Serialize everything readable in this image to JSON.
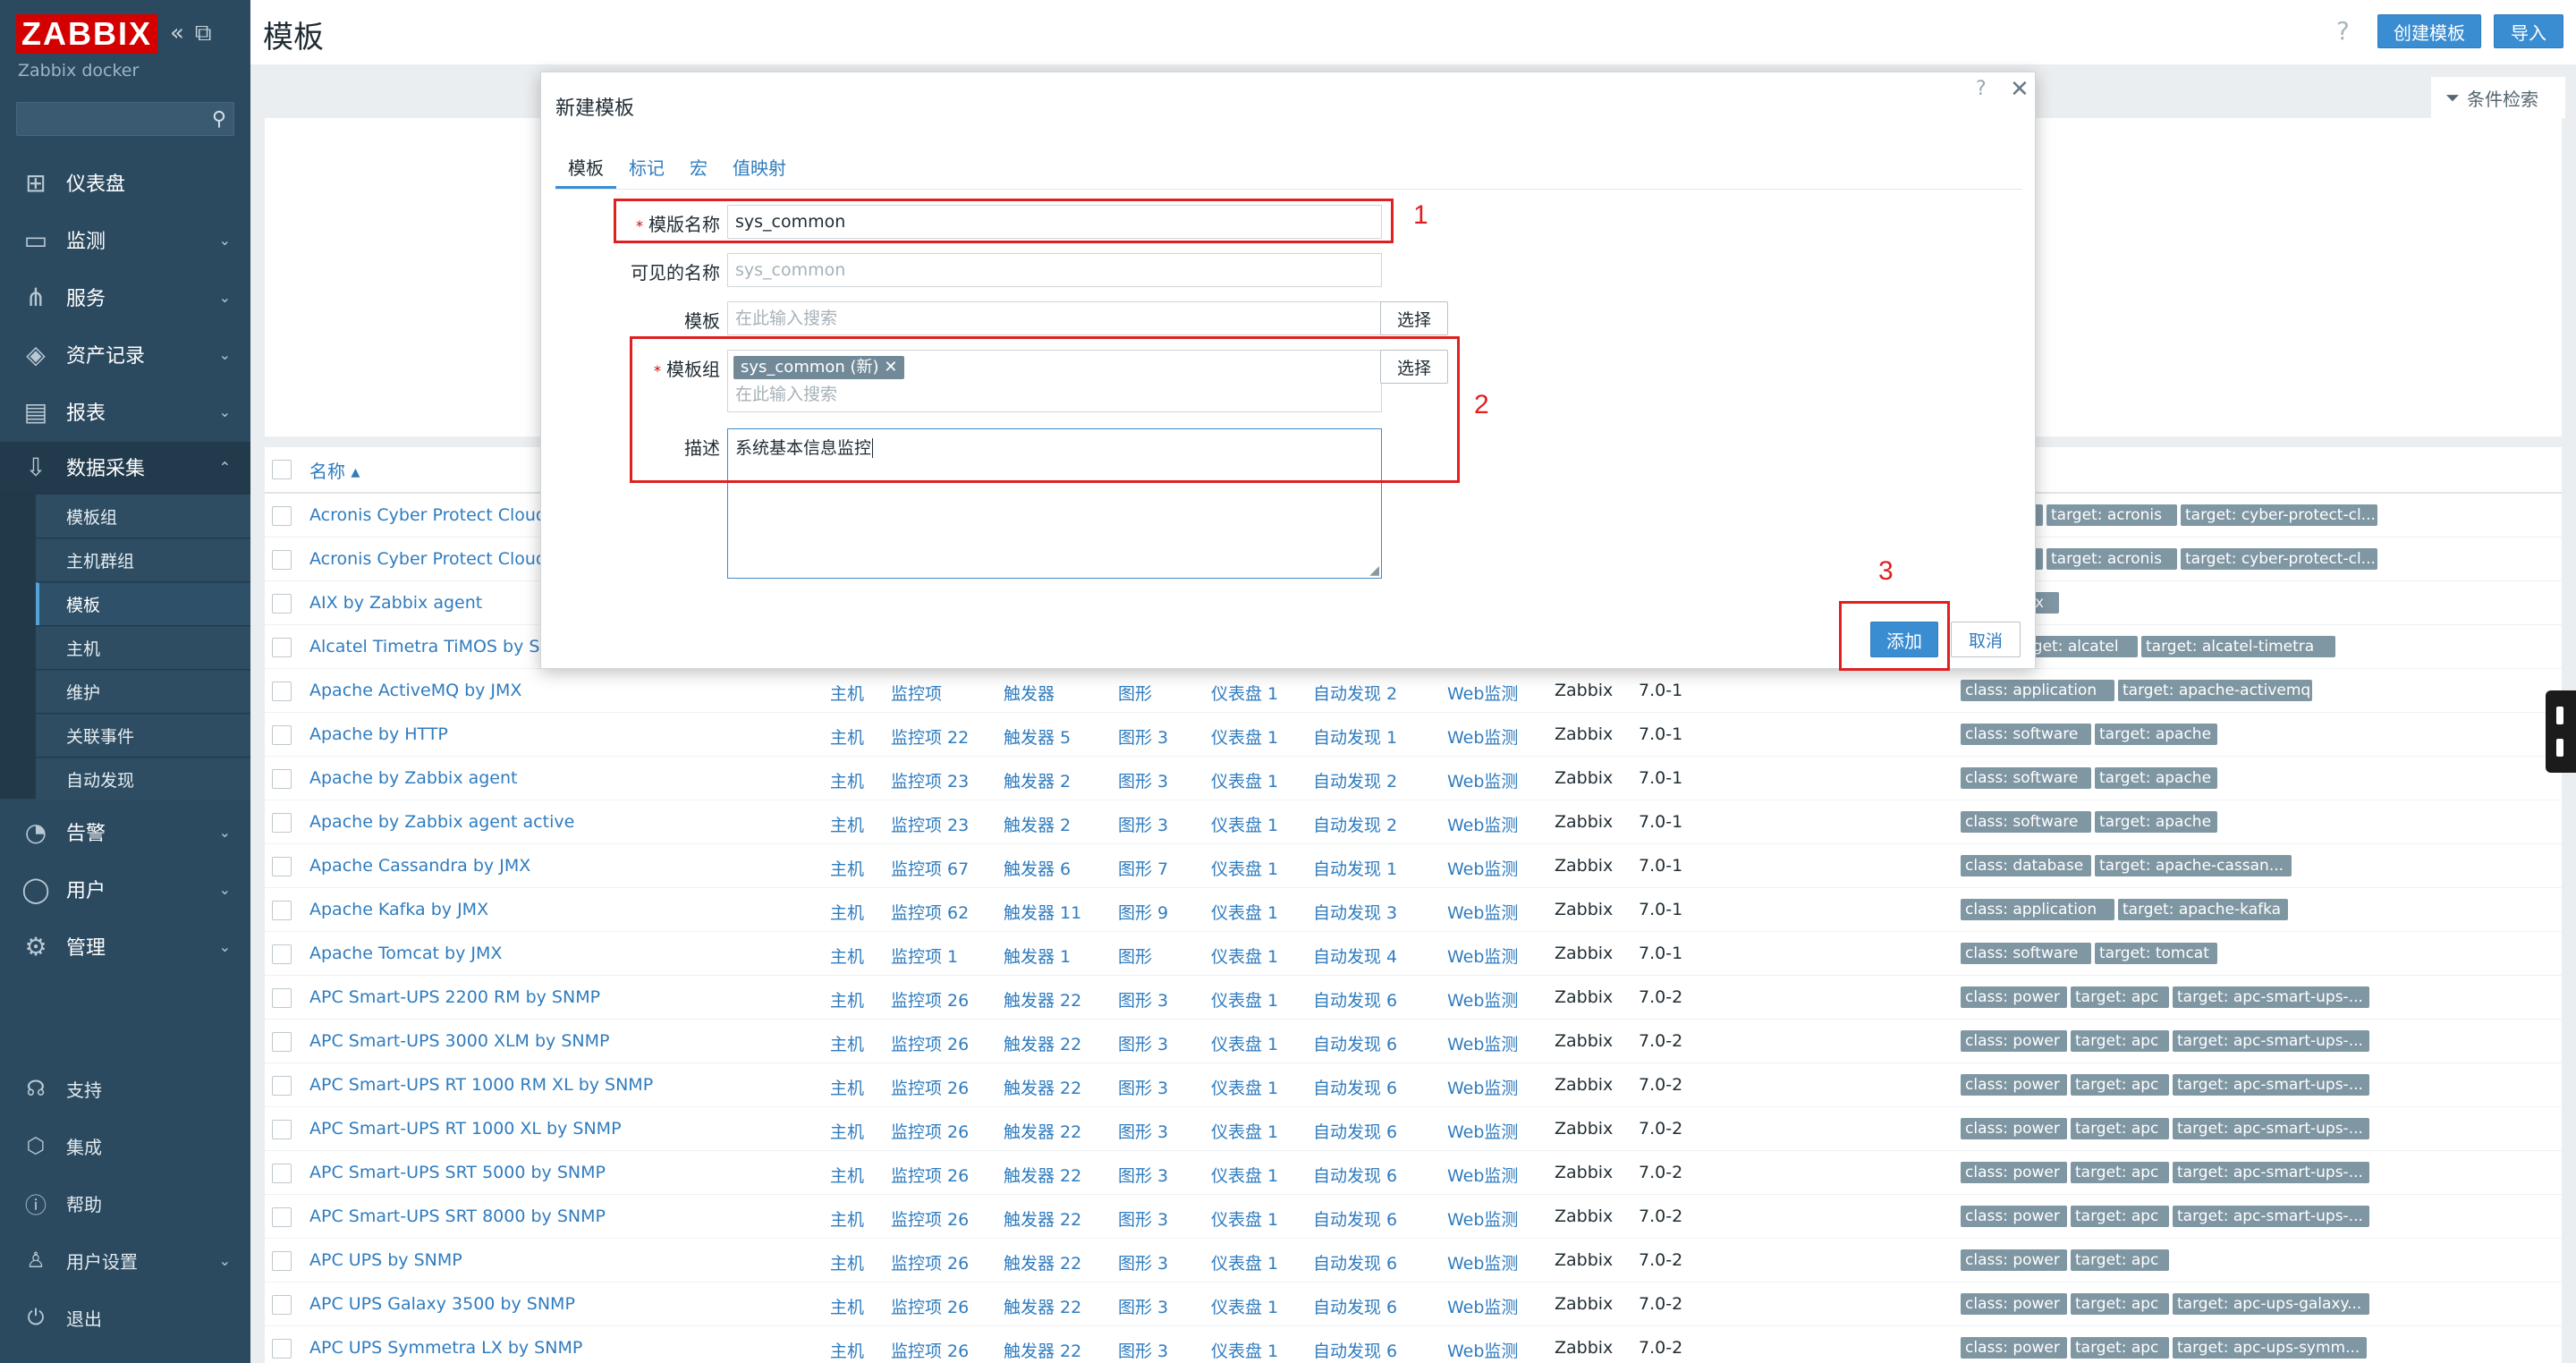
{
  "sidebar": {
    "logo": "ZABBIX",
    "collapse_icons": [
      "«",
      "⧉"
    ],
    "instance": "Zabbix docker",
    "search_placeholder": "",
    "menu": [
      {
        "label": "仪表盘",
        "icon": "dashboard-icon"
      },
      {
        "label": "监测",
        "icon": "monitoring-icon"
      },
      {
        "label": "服务",
        "icon": "services-icon"
      },
      {
        "label": "资产记录",
        "icon": "inventory-icon"
      },
      {
        "label": "报表",
        "icon": "reports-icon"
      },
      {
        "label": "数据采集",
        "icon": "data-collection-icon"
      }
    ],
    "submenu": [
      "模板组",
      "主机群组",
      "模板",
      "主机",
      "维护",
      "关联事件",
      "自动发现"
    ],
    "menu2": [
      {
        "label": "告警",
        "icon": "alerts-icon"
      },
      {
        "label": "用户",
        "icon": "users-icon"
      },
      {
        "label": "管理",
        "icon": "administration-icon"
      }
    ],
    "bottom": [
      {
        "label": "支持",
        "icon": "support-icon"
      },
      {
        "label": "集成",
        "icon": "integrations-icon"
      },
      {
        "label": "帮助",
        "icon": "help-icon"
      },
      {
        "label": "用户设置",
        "icon": "user-settings-icon"
      },
      {
        "label": "退出",
        "icon": "logout-icon"
      }
    ]
  },
  "header": {
    "title": "模板",
    "help": "?",
    "create_button": "创建模板",
    "import_button": "导入",
    "filter_label": "条件检索"
  },
  "table": {
    "name_header": "名称 ▴",
    "rows": [
      {
        "name": "Acronis Cyber Protect Cloud b",
        "tags": [
          "plication",
          "target: acronis",
          "target: cyber-protect-cl..."
        ]
      },
      {
        "name": "Acronis Cyber Protect Cloud M",
        "tags": [
          "plication",
          "target: acronis",
          "target: cyber-protect-cl..."
        ]
      },
      {
        "name": "AIX by Zabbix agent",
        "tags": [
          "target: aix"
        ]
      },
      {
        "name": "Alcatel Timetra TiMOS by SNM",
        "tags": [
          "work",
          "target: alcatel",
          "target: alcatel-timetra"
        ]
      },
      {
        "name": "Apache ActiveMQ by JMX",
        "hosts": "主机",
        "items": "监控项",
        "triggers": "触发器",
        "graphs": "图形",
        "dashboards": "仪表盘 1",
        "discovery": "自动发现 2",
        "web": "Web监测",
        "vendor": "Zabbix",
        "version": "7.0-1",
        "tags": [
          "class: application",
          "target: apache-activemq"
        ]
      },
      {
        "name": "Apache by HTTP",
        "hosts": "主机",
        "items": "监控项 22",
        "triggers": "触发器 5",
        "graphs": "图形 3",
        "dashboards": "仪表盘 1",
        "discovery": "自动发现 1",
        "web": "Web监测",
        "vendor": "Zabbix",
        "version": "7.0-1",
        "tags": [
          "class: software",
          "target: apache"
        ]
      },
      {
        "name": "Apache by Zabbix agent",
        "hosts": "主机",
        "items": "监控项 23",
        "triggers": "触发器 2",
        "graphs": "图形 3",
        "dashboards": "仪表盘 1",
        "discovery": "自动发现 2",
        "web": "Web监测",
        "vendor": "Zabbix",
        "version": "7.0-1",
        "tags": [
          "class: software",
          "target: apache"
        ]
      },
      {
        "name": "Apache by Zabbix agent active",
        "hosts": "主机",
        "items": "监控项 23",
        "triggers": "触发器 2",
        "graphs": "图形 3",
        "dashboards": "仪表盘 1",
        "discovery": "自动发现 2",
        "web": "Web监测",
        "vendor": "Zabbix",
        "version": "7.0-1",
        "tags": [
          "class: software",
          "target: apache"
        ]
      },
      {
        "name": "Apache Cassandra by JMX",
        "hosts": "主机",
        "items": "监控项 67",
        "triggers": "触发器 6",
        "graphs": "图形 7",
        "dashboards": "仪表盘 1",
        "discovery": "自动发现 1",
        "web": "Web监测",
        "vendor": "Zabbix",
        "version": "7.0-1",
        "tags": [
          "class: database",
          "target: apache-cassan..."
        ]
      },
      {
        "name": "Apache Kafka by JMX",
        "hosts": "主机",
        "items": "监控项 62",
        "triggers": "触发器 11",
        "graphs": "图形 9",
        "dashboards": "仪表盘 1",
        "discovery": "自动发现 3",
        "web": "Web监测",
        "vendor": "Zabbix",
        "version": "7.0-1",
        "tags": [
          "class: application",
          "target: apache-kafka"
        ]
      },
      {
        "name": "Apache Tomcat by JMX",
        "hosts": "主机",
        "items": "监控项 1",
        "triggers": "触发器 1",
        "graphs": "图形",
        "dashboards": "仪表盘 1",
        "discovery": "自动发现 4",
        "web": "Web监测",
        "vendor": "Zabbix",
        "version": "7.0-1",
        "tags": [
          "class: software",
          "target: tomcat"
        ]
      },
      {
        "name": "APC Smart-UPS 2200 RM by SNMP",
        "hosts": "主机",
        "items": "监控项 26",
        "triggers": "触发器 22",
        "graphs": "图形 3",
        "dashboards": "仪表盘 1",
        "discovery": "自动发现 6",
        "web": "Web监测",
        "vendor": "Zabbix",
        "version": "7.0-2",
        "tags": [
          "class: power",
          "target: apc",
          "target: apc-smart-ups-..."
        ]
      },
      {
        "name": "APC Smart-UPS 3000 XLM by SNMP",
        "hosts": "主机",
        "items": "监控项 26",
        "triggers": "触发器 22",
        "graphs": "图形 3",
        "dashboards": "仪表盘 1",
        "discovery": "自动发现 6",
        "web": "Web监测",
        "vendor": "Zabbix",
        "version": "7.0-2",
        "tags": [
          "class: power",
          "target: apc",
          "target: apc-smart-ups-..."
        ]
      },
      {
        "name": "APC Smart-UPS RT 1000 RM XL by SNMP",
        "hosts": "主机",
        "items": "监控项 26",
        "triggers": "触发器 22",
        "graphs": "图形 3",
        "dashboards": "仪表盘 1",
        "discovery": "自动发现 6",
        "web": "Web监测",
        "vendor": "Zabbix",
        "version": "7.0-2",
        "tags": [
          "class: power",
          "target: apc",
          "target: apc-smart-ups-..."
        ]
      },
      {
        "name": "APC Smart-UPS RT 1000 XL by SNMP",
        "hosts": "主机",
        "items": "监控项 26",
        "triggers": "触发器 22",
        "graphs": "图形 3",
        "dashboards": "仪表盘 1",
        "discovery": "自动发现 6",
        "web": "Web监测",
        "vendor": "Zabbix",
        "version": "7.0-2",
        "tags": [
          "class: power",
          "target: apc",
          "target: apc-smart-ups-..."
        ]
      },
      {
        "name": "APC Smart-UPS SRT 5000 by SNMP",
        "hosts": "主机",
        "items": "监控项 26",
        "triggers": "触发器 22",
        "graphs": "图形 3",
        "dashboards": "仪表盘 1",
        "discovery": "自动发现 6",
        "web": "Web监测",
        "vendor": "Zabbix",
        "version": "7.0-2",
        "tags": [
          "class: power",
          "target: apc",
          "target: apc-smart-ups-..."
        ]
      },
      {
        "name": "APC Smart-UPS SRT 8000 by SNMP",
        "hosts": "主机",
        "items": "监控项 26",
        "triggers": "触发器 22",
        "graphs": "图形 3",
        "dashboards": "仪表盘 1",
        "discovery": "自动发现 6",
        "web": "Web监测",
        "vendor": "Zabbix",
        "version": "7.0-2",
        "tags": [
          "class: power",
          "target: apc",
          "target: apc-smart-ups-..."
        ]
      },
      {
        "name": "APC UPS by SNMP",
        "hosts": "主机",
        "items": "监控项 26",
        "triggers": "触发器 22",
        "graphs": "图形 3",
        "dashboards": "仪表盘 1",
        "discovery": "自动发现 6",
        "web": "Web监测",
        "vendor": "Zabbix",
        "version": "7.0-2",
        "tags": [
          "class: power",
          "target: apc"
        ]
      },
      {
        "name": "APC UPS Galaxy 3500 by SNMP",
        "hosts": "主机",
        "items": "监控项 26",
        "triggers": "触发器 22",
        "graphs": "图形 3",
        "dashboards": "仪表盘 1",
        "discovery": "自动发现 6",
        "web": "Web监测",
        "vendor": "Zabbix",
        "version": "7.0-2",
        "tags": [
          "class: power",
          "target: apc",
          "target: apc-ups-galaxy..."
        ]
      },
      {
        "name": "APC UPS Symmetra LX by SNMP",
        "hosts": "主机",
        "items": "监控项 26",
        "triggers": "触发器 22",
        "graphs": "图形 3",
        "dashboards": "仪表盘 1",
        "discovery": "自动发现 6",
        "web": "Web监测",
        "vendor": "Zabbix",
        "version": "7.0-2",
        "tags": [
          "class: power",
          "target: apc",
          "target: apc-ups-symm..."
        ]
      }
    ]
  },
  "modal": {
    "title": "新建模板",
    "help": "?",
    "close": "✕",
    "tabs": [
      "模板",
      "标记",
      "宏",
      "值映射"
    ],
    "fields": {
      "template_name_label": "模版名称",
      "template_name_value": "sys_common",
      "visible_name_label": "可见的名称",
      "visible_name_placeholder": "sys_common",
      "templates_label": "模板",
      "templates_placeholder": "在此输入搜索",
      "templates_select": "选择",
      "groups_label": "模板组",
      "groups_chip": "sys_common (新)",
      "groups_placeholder": "在此输入搜索",
      "groups_select": "选择",
      "description_label": "描述",
      "description_value": "系统基本信息监控"
    },
    "add_button": "添加",
    "cancel_button": "取消"
  },
  "annotations": [
    "1",
    "2",
    "3"
  ],
  "colors": {
    "sidebar": "#2b4a60",
    "accent": "#3b8dd2",
    "logo": "#d40000",
    "annotation": "#e02020"
  }
}
